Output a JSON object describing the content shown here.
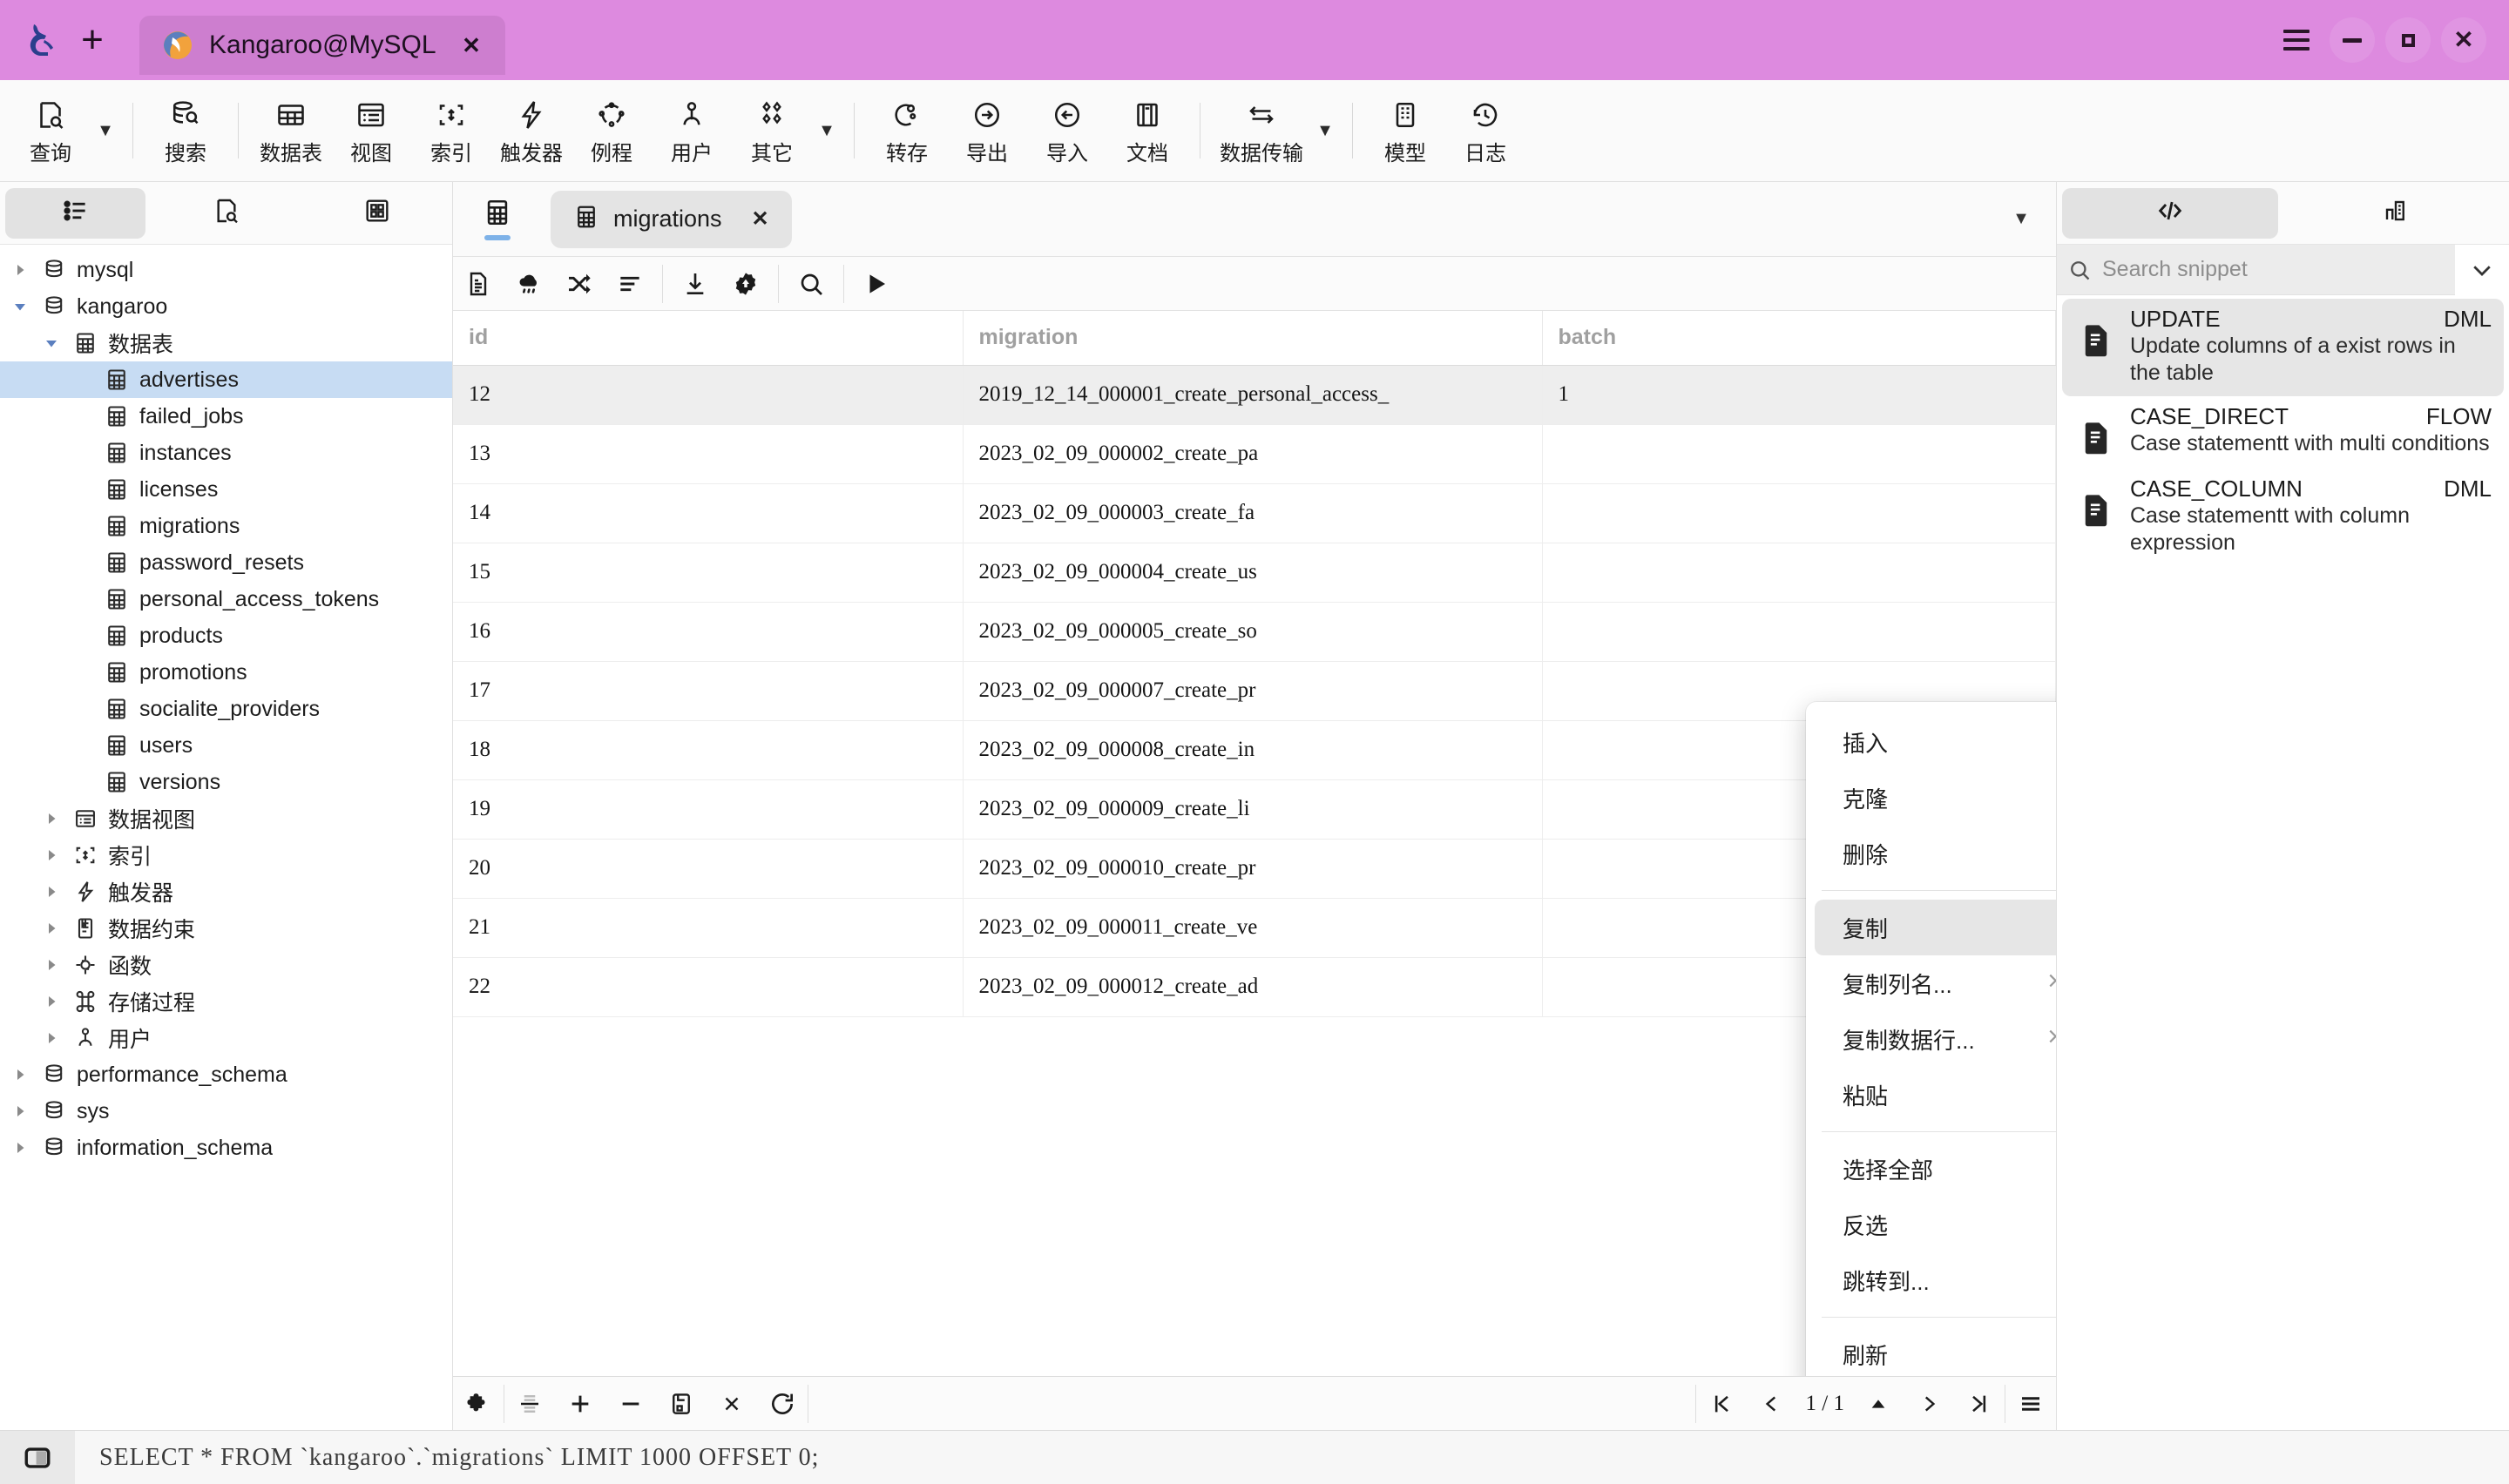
{
  "titlebar": {
    "tab_title": "Kangaroo@MySQL",
    "close_label": "✕",
    "new_tab_label": "+"
  },
  "toolbar": {
    "items": [
      {
        "label": "查询",
        "icon": "query-icon",
        "caret": true
      },
      {
        "label": "搜索",
        "icon": "search-db-icon",
        "caret": false
      },
      {
        "label": "数据表",
        "icon": "table-icon",
        "caret": false
      },
      {
        "label": "视图",
        "icon": "view-icon",
        "caret": false
      },
      {
        "label": "索引",
        "icon": "index-icon",
        "caret": false
      },
      {
        "label": "触发器",
        "icon": "trigger-icon",
        "caret": false
      },
      {
        "label": "例程",
        "icon": "routine-icon",
        "caret": false
      },
      {
        "label": "用户",
        "icon": "user-icon",
        "caret": false
      },
      {
        "label": "其它",
        "icon": "other-icon",
        "caret": true
      },
      {
        "label": "转存",
        "icon": "dump-icon",
        "caret": false
      },
      {
        "label": "导出",
        "icon": "export-icon",
        "caret": false
      },
      {
        "label": "导入",
        "icon": "import-icon",
        "caret": false
      },
      {
        "label": "文档",
        "icon": "doc-icon",
        "caret": false
      },
      {
        "label": "数据传输",
        "icon": "transfer-icon",
        "caret": true
      },
      {
        "label": "模型",
        "icon": "model-icon",
        "caret": false
      },
      {
        "label": "日志",
        "icon": "log-icon",
        "caret": false
      }
    ]
  },
  "sidebar": {
    "tabs": [
      {
        "name": "object-list-tab",
        "icon": "list-icon",
        "active": true
      },
      {
        "name": "query-search-tab",
        "icon": "doc-search-icon",
        "active": false
      },
      {
        "name": "grid-view-tab",
        "icon": "grid-squares-icon",
        "active": false
      }
    ],
    "tree": [
      {
        "label": "mysql",
        "icon": "database-icon",
        "indent": 0,
        "arrow": "collapsed",
        "selected": false
      },
      {
        "label": "kangaroo",
        "icon": "database-icon",
        "indent": 0,
        "arrow": "expanded",
        "selected": false
      },
      {
        "label": "数据表",
        "icon": "table-icon",
        "indent": 1,
        "arrow": "expanded",
        "selected": false
      },
      {
        "label": "advertises",
        "icon": "table-icon",
        "indent": 2,
        "arrow": "none",
        "selected": true
      },
      {
        "label": "failed_jobs",
        "icon": "table-icon",
        "indent": 2,
        "arrow": "none",
        "selected": false
      },
      {
        "label": "instances",
        "icon": "table-icon",
        "indent": 2,
        "arrow": "none",
        "selected": false
      },
      {
        "label": "licenses",
        "icon": "table-icon",
        "indent": 2,
        "arrow": "none",
        "selected": false
      },
      {
        "label": "migrations",
        "icon": "table-icon",
        "indent": 2,
        "arrow": "none",
        "selected": false
      },
      {
        "label": "password_resets",
        "icon": "table-icon",
        "indent": 2,
        "arrow": "none",
        "selected": false
      },
      {
        "label": "personal_access_tokens",
        "icon": "table-icon",
        "indent": 2,
        "arrow": "none",
        "selected": false
      },
      {
        "label": "products",
        "icon": "table-icon",
        "indent": 2,
        "arrow": "none",
        "selected": false
      },
      {
        "label": "promotions",
        "icon": "table-icon",
        "indent": 2,
        "arrow": "none",
        "selected": false
      },
      {
        "label": "socialite_providers",
        "icon": "table-icon",
        "indent": 2,
        "arrow": "none",
        "selected": false
      },
      {
        "label": "users",
        "icon": "table-icon",
        "indent": 2,
        "arrow": "none",
        "selected": false
      },
      {
        "label": "versions",
        "icon": "table-icon",
        "indent": 2,
        "arrow": "none",
        "selected": false
      },
      {
        "label": "数据视图",
        "icon": "view-icon",
        "indent": 1,
        "arrow": "collapsed",
        "selected": false
      },
      {
        "label": "索引",
        "icon": "index-icon",
        "indent": 1,
        "arrow": "collapsed",
        "selected": false
      },
      {
        "label": "触发器",
        "icon": "trigger-icon",
        "indent": 1,
        "arrow": "collapsed",
        "selected": false
      },
      {
        "label": "数据约束",
        "icon": "constraint-icon",
        "indent": 1,
        "arrow": "collapsed",
        "selected": false
      },
      {
        "label": "函数",
        "icon": "function-icon",
        "indent": 1,
        "arrow": "collapsed",
        "selected": false
      },
      {
        "label": "存储过程",
        "icon": "procedure-icon",
        "indent": 1,
        "arrow": "collapsed",
        "selected": false
      },
      {
        "label": "用户",
        "icon": "user-icon",
        "indent": 1,
        "arrow": "collapsed",
        "selected": false
      },
      {
        "label": "performance_schema",
        "icon": "database-icon",
        "indent": 0,
        "arrow": "collapsed",
        "selected": false
      },
      {
        "label": "sys",
        "icon": "database-icon",
        "indent": 0,
        "arrow": "collapsed",
        "selected": false
      },
      {
        "label": "information_schema",
        "icon": "database-icon",
        "indent": 0,
        "arrow": "collapsed",
        "selected": false
      }
    ]
  },
  "center": {
    "tab": {
      "label": "migrations",
      "close_label": "✕",
      "icon": "table-icon"
    },
    "grid_toolbar": [
      {
        "name": "data-icon",
        "glyph": "doc"
      },
      {
        "name": "rain-cloud-icon",
        "glyph": "cloud"
      },
      {
        "name": "shuffle-icon",
        "glyph": "shuffle"
      },
      {
        "name": "sort-icon",
        "glyph": "sort"
      },
      {
        "name": "download-icon",
        "glyph": "download"
      },
      {
        "name": "settings-icon",
        "glyph": "gear"
      },
      {
        "name": "search-icon",
        "glyph": "search"
      },
      {
        "name": "run-icon",
        "glyph": "play"
      }
    ],
    "columns": [
      "id",
      "migration",
      "batch"
    ],
    "rows": [
      {
        "id": "12",
        "migration": "2019_12_14_000001_create_personal_access_",
        "batch": "1",
        "selected": true
      },
      {
        "id": "13",
        "migration": "2023_02_09_000002_create_pa",
        "batch": "",
        "selected": false
      },
      {
        "id": "14",
        "migration": "2023_02_09_000003_create_fa",
        "batch": "",
        "selected": false
      },
      {
        "id": "15",
        "migration": "2023_02_09_000004_create_us",
        "batch": "",
        "selected": false
      },
      {
        "id": "16",
        "migration": "2023_02_09_000005_create_so",
        "batch": "",
        "selected": false
      },
      {
        "id": "17",
        "migration": "2023_02_09_000007_create_pr",
        "batch": "",
        "selected": false
      },
      {
        "id": "18",
        "migration": "2023_02_09_000008_create_in",
        "batch": "",
        "selected": false
      },
      {
        "id": "19",
        "migration": "2023_02_09_000009_create_li",
        "batch": "",
        "selected": false
      },
      {
        "id": "20",
        "migration": "2023_02_09_000010_create_pr",
        "batch": "",
        "selected": false
      },
      {
        "id": "21",
        "migration": "2023_02_09_000011_create_ve",
        "batch": "",
        "selected": false
      },
      {
        "id": "22",
        "migration": "2023_02_09_000012_create_ad",
        "batch": "",
        "selected": false
      }
    ],
    "footer_buttons": [
      {
        "name": "plugin-icon",
        "glyph": "puzzle"
      },
      {
        "name": "filter-rows-icon",
        "glyph": "rows"
      },
      {
        "name": "add-row-icon",
        "glyph": "plus"
      },
      {
        "name": "remove-row-icon",
        "glyph": "minus"
      },
      {
        "name": "save-row-icon",
        "glyph": "save"
      },
      {
        "name": "cancel-icon",
        "glyph": "x"
      },
      {
        "name": "refresh-icon",
        "glyph": "refresh"
      }
    ],
    "pager": {
      "first": "⏮",
      "prev": "‹",
      "text": "1 / 1",
      "up": "▲",
      "next": "›",
      "last": "⏭",
      "menu": "☰"
    }
  },
  "context_menu": {
    "items": [
      {
        "label": "插入",
        "submenu": false,
        "highlight": false,
        "sep_after": false
      },
      {
        "label": "克隆",
        "submenu": false,
        "highlight": false,
        "sep_after": false
      },
      {
        "label": "删除",
        "submenu": false,
        "highlight": false,
        "sep_after": true
      },
      {
        "label": "复制",
        "submenu": false,
        "highlight": true,
        "sep_after": false
      },
      {
        "label": "复制列名...",
        "submenu": true,
        "highlight": false,
        "sep_after": false
      },
      {
        "label": "复制数据行...",
        "submenu": true,
        "highlight": false,
        "sep_after": false
      },
      {
        "label": "粘贴",
        "submenu": false,
        "highlight": false,
        "sep_after": true
      },
      {
        "label": "选择全部",
        "submenu": false,
        "highlight": false,
        "sep_after": false
      },
      {
        "label": "反选",
        "submenu": false,
        "highlight": false,
        "sep_after": false
      },
      {
        "label": "跳转到...",
        "submenu": false,
        "highlight": false,
        "sep_after": true
      },
      {
        "label": "刷新",
        "submenu": false,
        "highlight": false,
        "sep_after": false
      }
    ],
    "submenu_glyph": "›"
  },
  "right_panel": {
    "tabs": [
      {
        "name": "snippet-tab",
        "icon": "code-icon",
        "active": true
      },
      {
        "name": "structure-tab",
        "icon": "building-icon",
        "active": false
      }
    ],
    "search": {
      "placeholder": "Search snippet",
      "value": ""
    },
    "snippets": [
      {
        "title": "UPDATE",
        "kind": "DML",
        "desc": "Update columns of a exist rows in the table",
        "active": true
      },
      {
        "title": "CASE_DIRECT",
        "kind": "FLOW",
        "desc": "Case statementt with multi conditions",
        "active": false
      },
      {
        "title": "CASE_COLUMN",
        "kind": "DML",
        "desc": "Case statementt with column expression",
        "active": false
      }
    ]
  },
  "statusbar": {
    "sql": "SELECT * FROM `kangaroo`.`migrations` LIMIT 1000 OFFSET 0;"
  },
  "colors": {
    "titlebar": "#dd8adf",
    "tab_active": "#cd7ecf",
    "selection": "#c7dcf3",
    "row_selected": "#eeeeee",
    "tab_underline": "#7eb2e8"
  }
}
